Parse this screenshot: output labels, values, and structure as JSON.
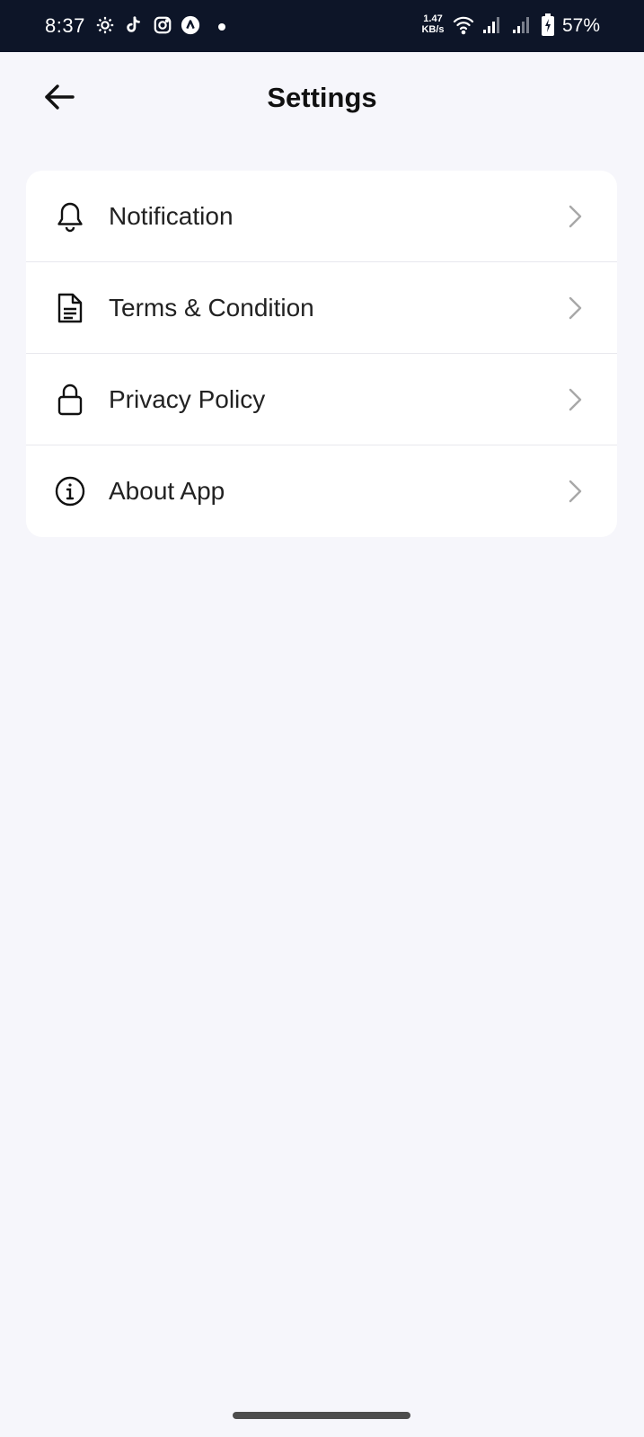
{
  "status_bar": {
    "time": "8:37",
    "net_speed_value": "1.47",
    "net_speed_unit": "KB/s",
    "battery_percent": "57%",
    "icons": [
      "settings-gear-icon",
      "tiktok-icon",
      "instagram-icon",
      "app-a-icon",
      "notification-dot",
      "wifi-icon",
      "signal-icon",
      "signal-icon",
      "battery-charging-icon"
    ]
  },
  "header": {
    "title": "Settings",
    "back_icon": "arrow-left-icon"
  },
  "settings": {
    "items": [
      {
        "label": "Notification",
        "icon": "bell-icon"
      },
      {
        "label": "Terms & Condition",
        "icon": "document-icon"
      },
      {
        "label": "Privacy Policy",
        "icon": "lock-icon"
      },
      {
        "label": "About App",
        "icon": "info-icon"
      }
    ]
  },
  "colors": {
    "status_bar_bg": "#0d1528",
    "page_bg": "#f6f6fb",
    "card_bg": "#ffffff",
    "chevron": "#a8a8a8",
    "text": "#222222"
  }
}
